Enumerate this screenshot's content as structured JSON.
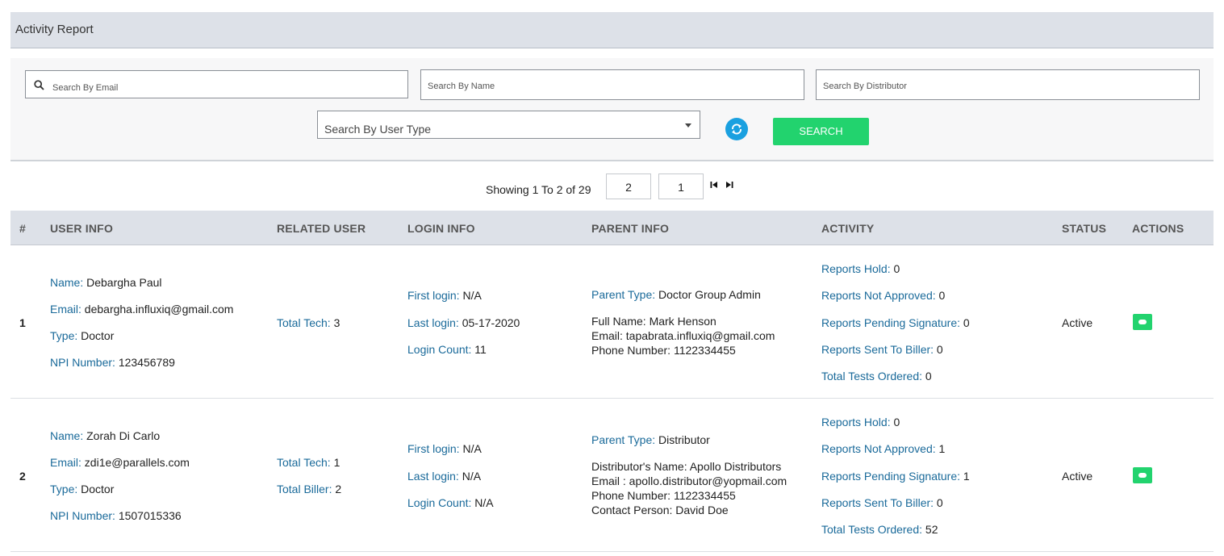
{
  "header": {
    "title": "Activity Report"
  },
  "filters": {
    "email_placeholder": "Search By Email",
    "name_placeholder": "Search By Name",
    "distributor_placeholder": "Search By Distributor",
    "user_type_placeholder": "Search By User Type",
    "search_label": "SEARCH"
  },
  "pager": {
    "text": "Showing 1 To 2 of 29",
    "page_size": "2",
    "page": "1"
  },
  "columns": [
    "#",
    "USER INFO",
    "RELATED USER",
    "LOGIN INFO",
    "PARENT INFO",
    "ACTIVITY",
    "STATUS",
    "ACTIONS"
  ],
  "labels": {
    "name": "Name:",
    "email": "Email:",
    "type": "Type:",
    "npi": "NPI Number:",
    "total_tech": "Total Tech:",
    "total_biller": "Total Biller:",
    "first_login": "First login:",
    "last_login": "Last login:",
    "login_count": "Login Count:",
    "parent_type": "Parent Type:",
    "reports_hold": "Reports Hold:",
    "reports_not_approved": "Reports Not Approved:",
    "reports_pending_signature": "Reports Pending Signature:",
    "reports_sent_to_biller": "Reports Sent To Biller:",
    "total_tests_ordered": "Total Tests Ordered:"
  },
  "rows": [
    {
      "index": "1",
      "name": "Debargha Paul",
      "email": "debargha.influxiq@gmail.com",
      "type": "Doctor",
      "npi": "123456789",
      "total_tech": "3",
      "first_login": "N/A",
      "last_login": "05-17-2020",
      "login_count": "11",
      "parent_type": "Doctor Group Admin",
      "parent_lines": [
        "Full Name: Mark Henson",
        "Email: tapabrata.influxiq@gmail.com",
        "Phone Number: 1122334455"
      ],
      "reports_hold": "0",
      "reports_not_approved": "0",
      "reports_pending_signature": "0",
      "reports_sent_to_biller": "0",
      "total_tests_ordered": "0",
      "status": "Active"
    },
    {
      "index": "2",
      "name": "Zorah Di Carlo",
      "email": "zdi1e@parallels.com",
      "type": "Doctor",
      "npi": "1507015336",
      "total_tech": "1",
      "total_biller": "2",
      "first_login": "N/A",
      "last_login": "N/A",
      "login_count": "N/A",
      "parent_type": "Distributor",
      "parent_lines": [
        "Distributor's Name: Apollo Distributors",
        "Email : apollo.distributor@yopmail.com",
        "Phone Number: 1122334455",
        "Contact Person: David Doe"
      ],
      "reports_hold": "0",
      "reports_not_approved": "1",
      "reports_pending_signature": "1",
      "reports_sent_to_biller": "0",
      "total_tests_ordered": "52",
      "status": "Active"
    }
  ]
}
